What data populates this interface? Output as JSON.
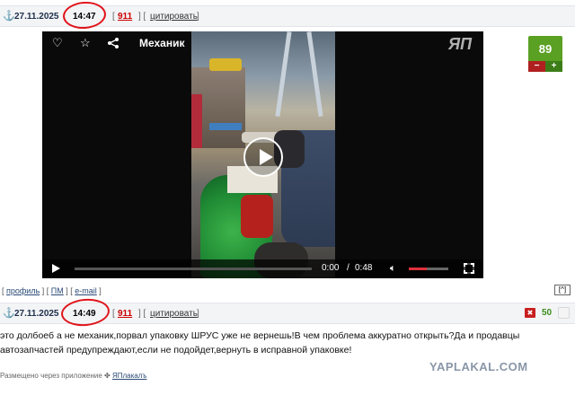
{
  "post1": {
    "date": "27.11.2025",
    "time": "14:47",
    "number": "911",
    "quote_label": "цитировать",
    "bracket_open": "[",
    "bracket_close": "]",
    "bracket_sep": "] ["
  },
  "video": {
    "title": "Механик",
    "logo_text": "ЯП",
    "current_time": "0:00",
    "separator": "/",
    "duration": "0:48",
    "volume_level": 0.45,
    "progress": 0.0,
    "icons": [
      "heart-icon",
      "star-icon",
      "share-icon",
      "play-icon",
      "volume-icon",
      "fullscreen-icon"
    ]
  },
  "rating": {
    "score": "89",
    "minus_label": "−",
    "plus_label": "+",
    "color": "#5aa023"
  },
  "profile_links": {
    "profile": "профиль",
    "pm": "ПМ",
    "email": "e-mail",
    "up": "[^]"
  },
  "post2": {
    "date": "27.11.2025",
    "time": "14:49",
    "number": "911",
    "quote_label": "цитировать",
    "score": "50",
    "text_line1": "это долбоеб а не механик,порвал упаковку ШРУС уже не вернешь!В чем проблема аккуратно открыть?Да и продавцы",
    "text_line2": "автозапчастей предупреждают,если не подойдет,вернуть в исправной упаковке!"
  },
  "footer": {
    "note": "Размещено через приложение",
    "app_link": "ЯПлакалъ",
    "watermark": "YAPLAKAL.COM"
  },
  "colors": {
    "accent_red": "#e0141b",
    "link_blue": "#2a4a76",
    "number_red": "#cc0000"
  }
}
